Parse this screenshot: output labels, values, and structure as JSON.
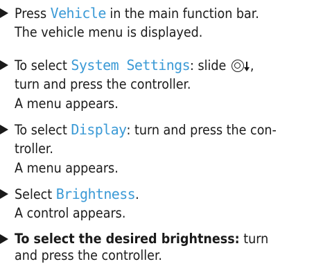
{
  "steps": [
    {
      "line1": {
        "before": "Press ",
        "term": "Vehicle",
        "after": " in the main function bar."
      },
      "line2": "The vehicle menu is displayed."
    },
    {
      "line1": {
        "before": "To select ",
        "term": "System Settings",
        "after": ": slide ",
        "after2": ","
      },
      "line2": "turn and press the controller.",
      "line3": "A menu appears."
    },
    {
      "line1": {
        "before": "To select ",
        "term": "Display",
        "after": ": turn and press the con-"
      },
      "line2": "troller.",
      "line3": "A menu appears."
    },
    {
      "line1": {
        "before": "Select ",
        "term": "Brightness",
        "after": "."
      },
      "line2": "A control appears."
    },
    {
      "line1": {
        "bold": "To select the desired brightness:",
        "after": " turn"
      },
      "line2": "and press the controller."
    }
  ],
  "icons": {
    "bullet": "triangle-right-icon",
    "controller": "controller-icon",
    "slide_down": "arrow-down-icon"
  },
  "colors": {
    "text": "#1a1a1a",
    "term": "#3b9ad6",
    "background": "#ffffff"
  }
}
